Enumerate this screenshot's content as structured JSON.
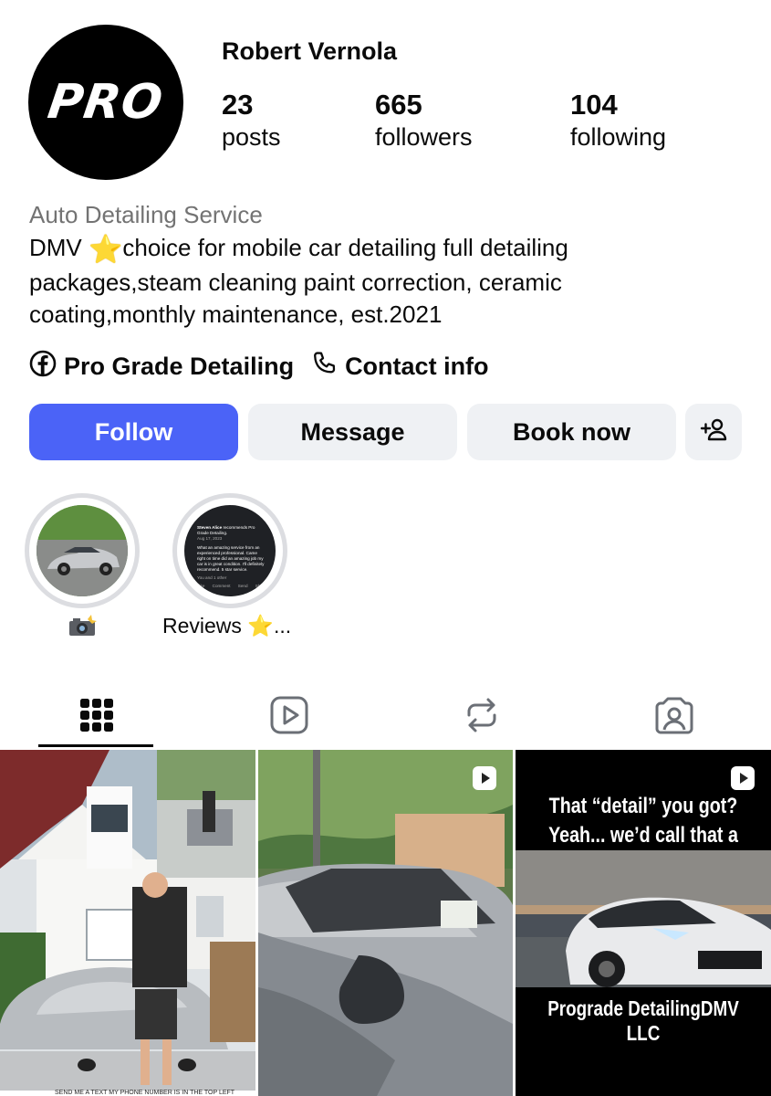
{
  "profile": {
    "avatar_text": "PRO",
    "username": "Robert Vernola",
    "stats": [
      {
        "value": "23",
        "label": "posts"
      },
      {
        "value": "665",
        "label": "followers"
      },
      {
        "value": "104",
        "label": "following"
      }
    ],
    "category": "Auto Detailing Service",
    "bio_line1_prefix": "DMV ",
    "bio_star": "⭐",
    "bio_line1_suffix": "choice for mobile car detailing full detailing",
    "bio_line2": "packages,steam cleaning paint correction, ceramic",
    "bio_line3": "coating,monthly maintenance, est.2021",
    "facebook_link": "Pro Grade Detailing",
    "contact_link": "Contact info"
  },
  "actions": {
    "follow": "Follow",
    "message": "Message",
    "book": "Book now"
  },
  "highlights": [
    {
      "label": "📸",
      "icon": "camera-flash-emoji"
    },
    {
      "label": "Reviews ⭐...",
      "review_name": "Steven Alice",
      "review_recommends": "recommends Pro Grade Detailing.",
      "review_date": "Aug 17, 2023",
      "review_text": "What an amazing service from an experienced professional. Came right on time did an amazing job my car is in great condition. I'll definitely recommend. 5 star service.",
      "review_reactions": "You and 1 other",
      "review_actions": [
        "Like",
        "Comment",
        "Send",
        "Share"
      ]
    }
  ],
  "tabs": [
    {
      "name": "grid-icon",
      "active": true
    },
    {
      "name": "reels-icon",
      "active": false
    },
    {
      "name": "reposts-icon",
      "active": false
    },
    {
      "name": "tagged-icon",
      "active": false
    }
  ],
  "posts": [
    {
      "type": "photo-collage",
      "bottom_text": "SEND ME A TEXT MY PHONE NUMBER IS IN THE TOP LEFT"
    },
    {
      "type": "reel"
    },
    {
      "type": "reel",
      "headline_line1": "That “detail” you got?",
      "headline_line2": "Yeah... we’d call that a wash.",
      "footer": "Prograde DetailingDMV LLC"
    }
  ],
  "colors": {
    "follow_blue": "#4b63f7",
    "button_grey": "#eff1f4",
    "category_grey": "#737373",
    "ring_grey": "#dcdde1"
  }
}
